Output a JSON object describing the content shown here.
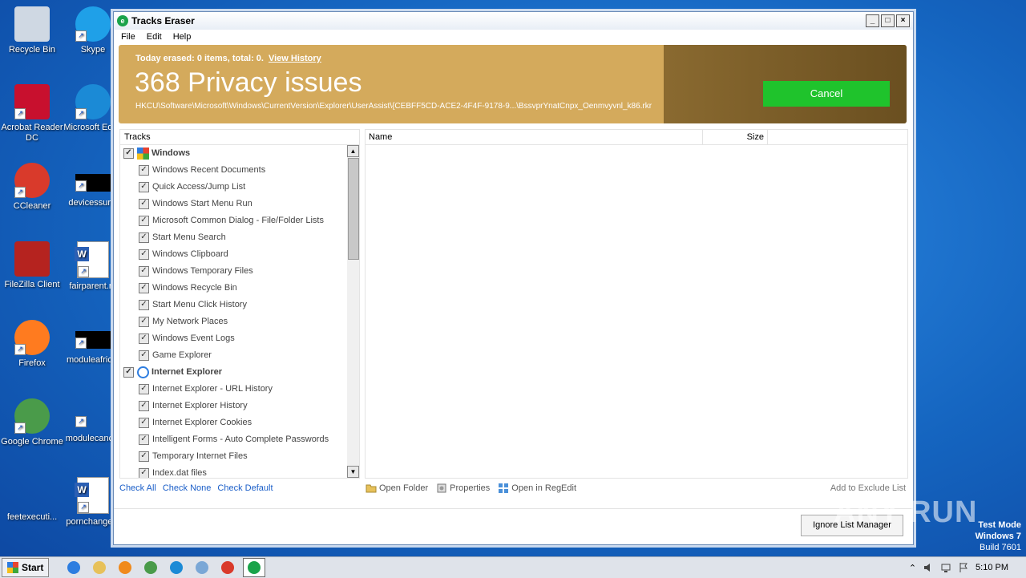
{
  "desktop": {
    "icons": [
      {
        "label": "Recycle Bin",
        "icon": "recycle-bin-icon"
      },
      {
        "label": "Skype",
        "icon": "skype-icon"
      },
      {
        "label": "Acrobat Reader DC",
        "icon": "acrobat-icon"
      },
      {
        "label": "Microsoft Edge",
        "icon": "edge-icon"
      },
      {
        "label": "CCleaner",
        "icon": "ccleaner-icon"
      },
      {
        "label": "devicessur...",
        "icon": "blank-file-icon"
      },
      {
        "label": "FileZilla Client",
        "icon": "filezilla-icon"
      },
      {
        "label": "fairparent.rtf",
        "icon": "word-doc-icon"
      },
      {
        "label": "Firefox",
        "icon": "firefox-icon"
      },
      {
        "label": "moduleafric...",
        "icon": "blank-file-icon"
      },
      {
        "label": "Google Chrome",
        "icon": "chrome-icon"
      },
      {
        "label": "modulecanc...",
        "icon": "blank-file-icon"
      },
      {
        "label": "feetexecuti...",
        "icon": "blank-file-icon"
      },
      {
        "label": "pornchange...",
        "icon": "word-doc-icon"
      }
    ]
  },
  "window": {
    "title": "Tracks Eraser",
    "controls": {
      "minimize": "_",
      "maximize": "□",
      "close": "×"
    },
    "menu": [
      "File",
      "Edit",
      "Help"
    ]
  },
  "banner": {
    "today": "Today erased: 0 items, total: 0.",
    "view_history": "View History",
    "headline": "368 Privacy issues",
    "path": "HKCU\\Software\\Microsoft\\Windows\\CurrentVersion\\Explorer\\UserAssist\\{CEBFF5CD-ACE2-4F4F-9178-9...\\BssvprYnatCnpx_Oenmvyvnl_k86.rkr",
    "cancel": "Cancel",
    "accent": "#d4aa5c",
    "button_color": "#1fc32c"
  },
  "tracks": {
    "header": "Tracks",
    "groups": [
      {
        "label": "Windows",
        "icon": "windows-logo-icon",
        "checked": "✓",
        "items": [
          "Windows Recent Documents",
          "Quick Access/Jump List",
          "Windows Start Menu Run",
          "Microsoft Common Dialog - File/Folder Lists",
          "Start Menu Search",
          "Windows Clipboard",
          "Windows Temporary Files",
          "Windows Recycle Bin",
          "Start Menu Click History",
          "My Network Places",
          "Windows Event Logs",
          "Game Explorer"
        ]
      },
      {
        "label": "Internet Explorer",
        "icon": "internet-explorer-icon",
        "checked": "✓",
        "items": [
          "Internet Explorer - URL History",
          "Internet Explorer History",
          "Internet Explorer Cookies",
          "Intelligent Forms - Auto Complete Passwords",
          "Temporary Internet Files",
          "Index.dat files"
        ]
      }
    ]
  },
  "files": {
    "col_name": "Name",
    "col_size": "Size"
  },
  "bottom": {
    "check_all": "Check All",
    "check_none": "Check None",
    "check_default": "Check Default",
    "open_folder": "Open Folder",
    "properties": "Properties",
    "open_regedit": "Open in RegEdit",
    "add_exclude": "Add to Exclude List",
    "ignore_manager": "Ignore List Manager"
  },
  "watermark": "ANY RUN",
  "os_info": {
    "line1": "Test Mode",
    "line2": "Windows 7",
    "line3": "Build 7601"
  },
  "taskbar": {
    "start": "Start",
    "apps": [
      "internet-explorer-icon",
      "explorer-folder-icon",
      "media-player-icon",
      "chrome-icon",
      "edge-icon",
      "network-icon",
      "ccleaner-icon",
      "tracks-eraser-icon"
    ],
    "clock": "5:10 PM"
  }
}
